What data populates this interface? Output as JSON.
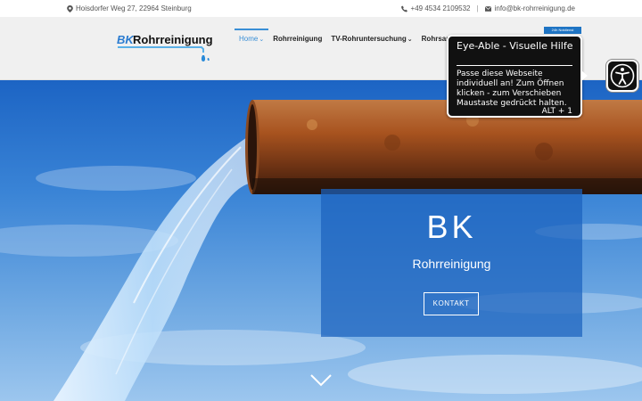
{
  "topbar": {
    "address": "Hoisdorfer Weg 27, 22964 Steinburg",
    "phone": "+49 4534 2109532",
    "email": "info@bk-rohrreinigung.de",
    "separator": "|"
  },
  "header": {
    "logo_text": "Rohrreinigung",
    "logo_prefix": "BK",
    "badge": "24h Notdienst",
    "nav": [
      {
        "label": "Home",
        "active": true,
        "dropdown": true
      },
      {
        "label": "Rohrreinigung",
        "active": false,
        "dropdown": false
      },
      {
        "label": "TV-Rohruntersuchung",
        "active": false,
        "dropdown": true
      },
      {
        "label": "Rohrsanierung",
        "active": false,
        "dropdown": false
      }
    ]
  },
  "hero": {
    "title": "BK",
    "subtitle": "Rohrreinigung",
    "button": "KONTAKT"
  },
  "tooltip": {
    "title": "Eye-Able - Visuelle Hilfe",
    "text": "Passe diese Webseite individuell an! Zum Öffnen klicken - zum Verschieben Maustaste gedrückt halten.",
    "shortcut": "ALT + 1"
  },
  "colors": {
    "accent": "#3a8fd6",
    "hero_box": "#1c62be",
    "tooltip_bg": "#111111"
  },
  "icons": {
    "address": "map-pin-icon",
    "phone": "phone-icon",
    "email": "envelope-icon",
    "scroll": "chevron-down-icon",
    "accessibility": "accessibility-person-icon"
  }
}
